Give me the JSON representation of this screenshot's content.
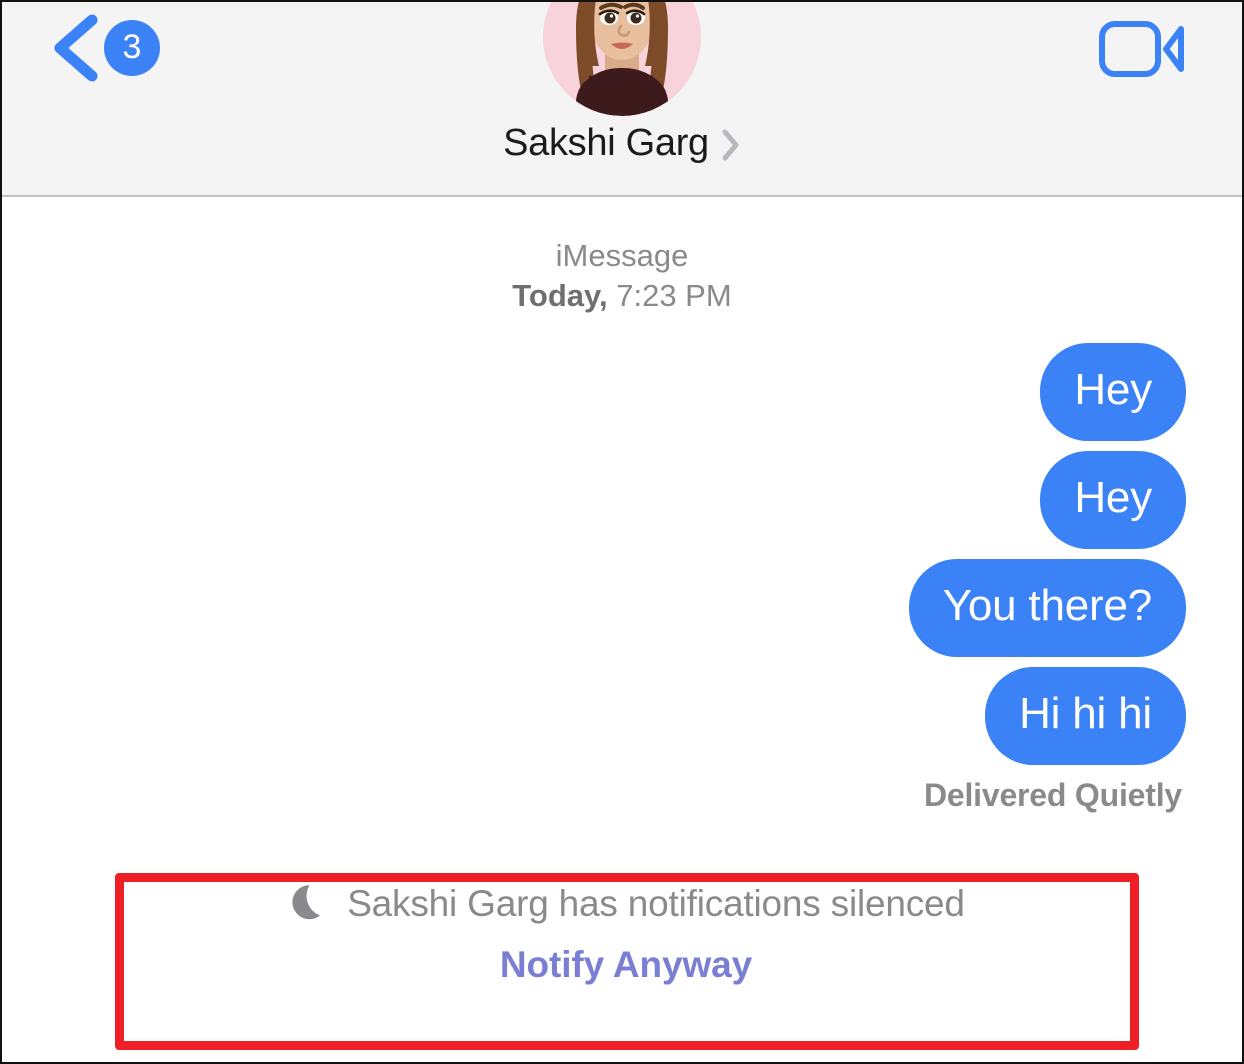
{
  "app": "Messages",
  "nav": {
    "back_icon": "chevron-left-icon",
    "unread_count": "3",
    "contact_name": "Sakshi Garg",
    "disclosure_icon": "chevron-right-icon",
    "facetime_icon": "video-camera-icon",
    "avatar_icon": "memoji-avatar"
  },
  "conversation": {
    "service": "iMessage",
    "day": "Today,",
    "time": "7:23 PM",
    "messages": [
      {
        "text": "Hey",
        "direction": "outgoing",
        "tail": false
      },
      {
        "text": "Hey",
        "direction": "outgoing",
        "tail": false
      },
      {
        "text": "You there?",
        "direction": "outgoing",
        "tail": false
      },
      {
        "text": "Hi hi hi",
        "direction": "outgoing",
        "tail": true
      }
    ],
    "delivery_status": "Delivered Quietly"
  },
  "silenced_banner": {
    "moon_icon": "crescent-moon-icon",
    "message": "Sakshi Garg has notifications silenced",
    "action_label": "Notify Anyway"
  },
  "colors": {
    "bubble_blue": "#3b82f6",
    "accent_blue": "#3b82f6",
    "notify_purple": "#7b7fd4",
    "annotation_red": "#ee1f25",
    "nav_background": "#f4f4f4",
    "secondary_text": "#8a8a8e",
    "avatar_background": "#f9d3dc"
  }
}
